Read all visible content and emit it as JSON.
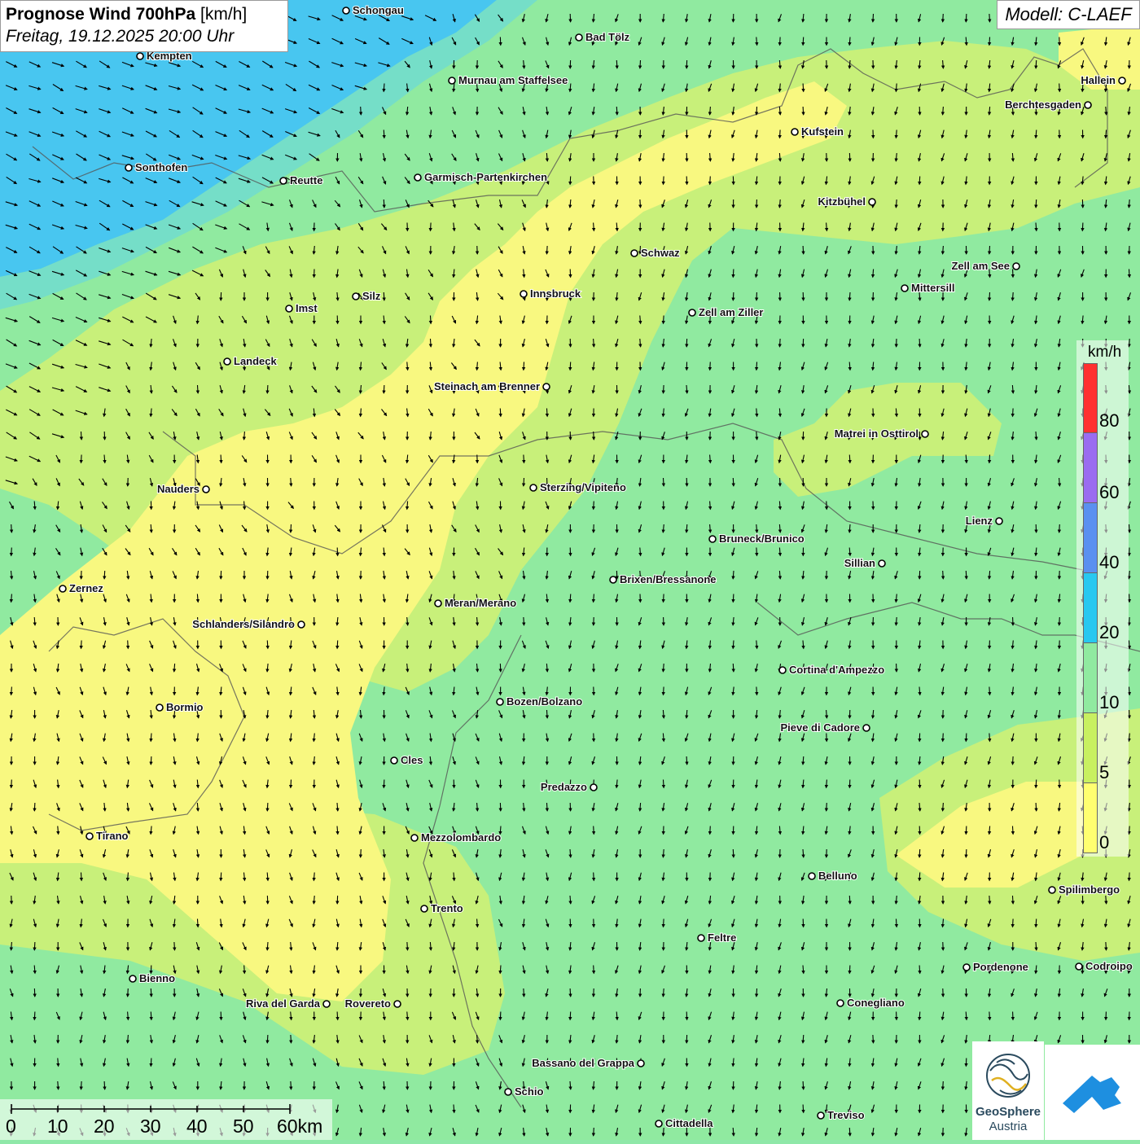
{
  "header": {
    "title_bold": "Prognose Wind 700hPa",
    "title_unit": " [km/h]",
    "datetime": "Freitag, 19.12.2025 20:00 Uhr",
    "model": "Modell: C-LAEF"
  },
  "legend": {
    "unit": "km/h",
    "labels": [
      "80",
      "60",
      "40",
      "20",
      "10",
      "5",
      "0"
    ],
    "colors": [
      "#ff3030",
      "#9a6cf0",
      "#5a90f0",
      "#28c8f0",
      "#90eaa0",
      "#c8f060",
      "#ffff70"
    ]
  },
  "scalebar": {
    "labels": [
      "0",
      "10",
      "20",
      "30",
      "40",
      "50",
      "60km"
    ]
  },
  "logo": {
    "name": "GeoSphere",
    "country": "Austria"
  },
  "map": {
    "wind_field": "mostly southward arrows, weak wind",
    "zones": {
      "west_strong": "#48c6f0",
      "green": "#90eaa0",
      "light_green": "#c8f07a",
      "yellow": "#f8f880"
    },
    "cities": [
      {
        "name": "Schongau"
      },
      {
        "name": "Kempten"
      },
      {
        "name": "Bad Tölz"
      },
      {
        "name": "Murnau am Staffelsee"
      },
      {
        "name": "Hallein"
      },
      {
        "name": "Berchtesgaden"
      },
      {
        "name": "Kufstein"
      },
      {
        "name": "Sonthofen"
      },
      {
        "name": "Reutte"
      },
      {
        "name": "Garmisch-Partenkirchen"
      },
      {
        "name": "Kitzbühel"
      },
      {
        "name": "Schwaz"
      },
      {
        "name": "Zell am See"
      },
      {
        "name": "Mittersill"
      },
      {
        "name": "Innsbruck"
      },
      {
        "name": "Silz"
      },
      {
        "name": "Imst"
      },
      {
        "name": "Zell am Ziller"
      },
      {
        "name": "Landeck"
      },
      {
        "name": "Steinach am Brenner"
      },
      {
        "name": "Matrei in Osttirol"
      },
      {
        "name": "Nauders"
      },
      {
        "name": "Sterzing/Vipiteno"
      },
      {
        "name": "Lienz"
      },
      {
        "name": "Bruneck/Brunico"
      },
      {
        "name": "Sillian"
      },
      {
        "name": "Brixen/Bressanone"
      },
      {
        "name": "Zernez"
      },
      {
        "name": "Meran/Merano"
      },
      {
        "name": "Schlanders/Silandro"
      },
      {
        "name": "Cortina d'Ampezzo"
      },
      {
        "name": "Bozen/Bolzano"
      },
      {
        "name": "Bormio"
      },
      {
        "name": "Pieve di Cadore"
      },
      {
        "name": "Cles"
      },
      {
        "name": "Predazzo"
      },
      {
        "name": "Tirano"
      },
      {
        "name": "Mezzolombardo"
      },
      {
        "name": "Belluno"
      },
      {
        "name": "Spilimbergo"
      },
      {
        "name": "Trento"
      },
      {
        "name": "Feltre"
      },
      {
        "name": "Bienno"
      },
      {
        "name": "Pordenone"
      },
      {
        "name": "Codroipo"
      },
      {
        "name": "Riva del Garda"
      },
      {
        "name": "Rovereto"
      },
      {
        "name": "Conegliano"
      },
      {
        "name": "Bassano del Grappa"
      },
      {
        "name": "Schio"
      },
      {
        "name": "Treviso"
      },
      {
        "name": "Cittadella"
      }
    ]
  }
}
